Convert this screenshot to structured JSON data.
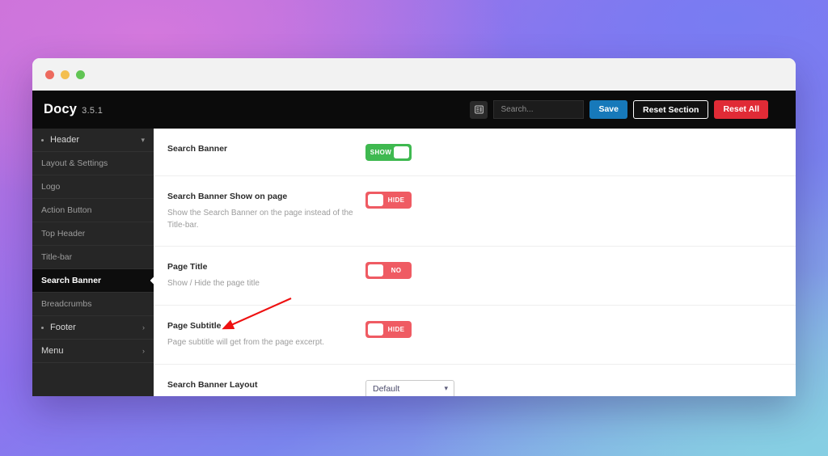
{
  "window": {
    "traffic_lights": [
      "close",
      "minimize",
      "maximize"
    ]
  },
  "topbar": {
    "brand_name": "Docy",
    "brand_version": "3.5.1",
    "panel_icon": "panel-list-icon",
    "search_placeholder": "Search...",
    "search_value": "",
    "save_label": "Save",
    "reset_section_label": "Reset Section",
    "reset_all_label": "Reset All",
    "colors": {
      "save": "#1779ba",
      "reset_all": "#e02b36",
      "bar_bg": "#0b0b0b"
    }
  },
  "sidebar": {
    "groups": [
      {
        "label": "Header",
        "state": "expanded",
        "chevron": "chevron-down-icon"
      }
    ],
    "items": [
      {
        "label": "Layout & Settings",
        "active": false
      },
      {
        "label": "Logo",
        "active": false
      },
      {
        "label": "Action Button",
        "active": false
      },
      {
        "label": "Top Header",
        "active": false
      },
      {
        "label": "Title-bar",
        "active": false
      },
      {
        "label": "Search Banner",
        "active": true
      },
      {
        "label": "Breadcrumbs",
        "active": false
      }
    ],
    "footer_group": {
      "label": "Footer",
      "state": "collapsed",
      "chevron": "chevron-right-icon"
    },
    "menu_group": {
      "label": "Menu",
      "state": "collapsed",
      "chevron": "chevron-right-icon"
    }
  },
  "settings": {
    "rows": [
      {
        "title": "Search Banner",
        "desc": "",
        "control": "toggle",
        "state": "on",
        "toggle_label": "SHOW"
      },
      {
        "title": "Search Banner Show on page",
        "desc": "Show the Search Banner on the page instead of the Title-bar.",
        "control": "toggle",
        "state": "off",
        "toggle_label": "HIDE"
      },
      {
        "title": "Page Title",
        "desc": "Show / Hide the page title",
        "control": "toggle",
        "state": "off",
        "toggle_label": "NO"
      },
      {
        "title": "Page Subtitle",
        "desc": "Page subtitle will get from the page excerpt.",
        "control": "toggle",
        "state": "off",
        "toggle_label": "HIDE"
      },
      {
        "title": "Search Banner Layout",
        "desc": "",
        "control": "select",
        "selected": "Default",
        "options": [
          "Default"
        ]
      }
    ]
  },
  "annotation": {
    "type": "arrow",
    "color": "#ee1111",
    "points_to": "Page Subtitle"
  }
}
